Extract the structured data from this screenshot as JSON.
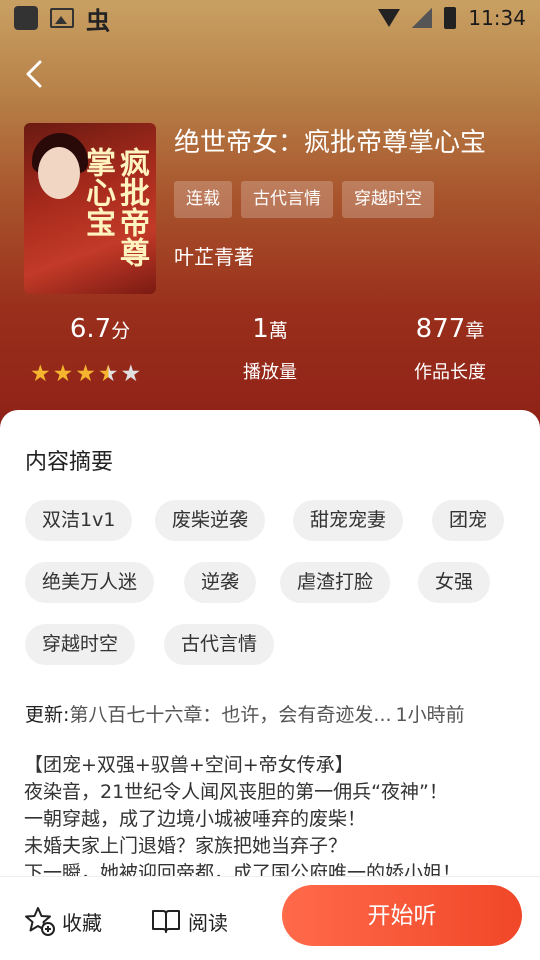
{
  "status_bar": {
    "time": "11:34",
    "app_char": "虫"
  },
  "book": {
    "title": "绝世帝女：疯批帝尊掌心宝",
    "tags": [
      "连载",
      "古代言情",
      "穿越时空"
    ],
    "author": "叶芷青著",
    "cover_title": "疯批帝尊掌心宝"
  },
  "stats": {
    "score": "6.7",
    "score_unit": "分",
    "rating_stars": 3.5,
    "plays": "1",
    "plays_unit": "萬",
    "plays_label": "播放量",
    "length": "877",
    "length_unit": "章",
    "length_label": "作品长度"
  },
  "summary": {
    "title": "内容摘要",
    "keywords": [
      "双洁1v1",
      "废柴逆袭",
      "甜宠宠妻",
      "团宠",
      "绝美万人迷",
      "逆袭",
      "虐渣打脸",
      "女强",
      "穿越时空",
      "古代言情"
    ],
    "update_label": "更新:",
    "update_chapter": "第八百七十六章：也许，会有奇迹发...",
    "update_time": "1小時前",
    "description": "【团宠+双强+驭兽+空间+帝女传承】\n夜染音，21世纪令人闻风丧胆的第一佣兵“夜神”！\n一朝穿越，成了边境小城被唾弃的废柴！\n未婚夫家上门退婚？家族把她当弃子？\n下一瞬，她被迎回帝都，成了国公府唯一的娇小姐！"
  },
  "actions": {
    "favorite": "收藏",
    "read": "阅读",
    "play": "开始听"
  },
  "colors": {
    "accent": "#f04728",
    "star": "#f5b52e",
    "hero_dark": "#8e2016"
  }
}
